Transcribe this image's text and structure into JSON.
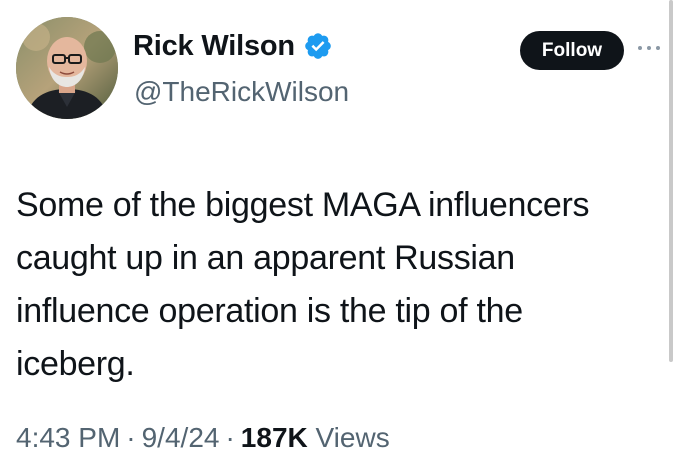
{
  "author": {
    "display_name": "Rick Wilson",
    "handle": "@TheRickWilson",
    "verified": true,
    "avatar_icon": "profile-photo-avatar"
  },
  "actions": {
    "follow_label": "Follow",
    "more_icon": "ellipsis-icon"
  },
  "tweet": {
    "text": "Some of the biggest MAGA influencers\ncaught up in an apparent Russian\ninfluence operation is the tip of the\niceberg.",
    "time": "4:43 PM",
    "date": "9/4/24",
    "views_count": "187K",
    "views_label": "Views",
    "separator": "·"
  },
  "colors": {
    "text_primary": "#0f1419",
    "text_secondary": "#536471",
    "verified_blue": "#1d9bf0",
    "follow_bg": "#0f1419"
  }
}
